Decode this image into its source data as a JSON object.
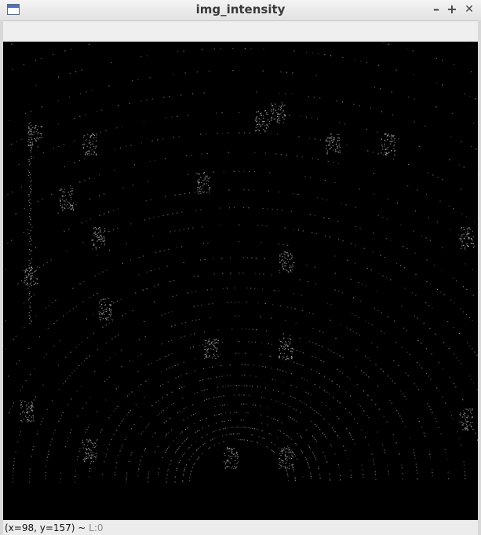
{
  "window": {
    "title": "img_intensity",
    "icon": "window-app-icon",
    "controls": {
      "minimize": "–",
      "maximize": "+",
      "close": "✕"
    }
  },
  "image": {
    "description_icon": "lidar-intensity-image",
    "background_color": "#000000",
    "point_color": "#bfbfbf"
  },
  "status": {
    "coords": "(x=98, y=157) ~",
    "level": " L:0"
  }
}
